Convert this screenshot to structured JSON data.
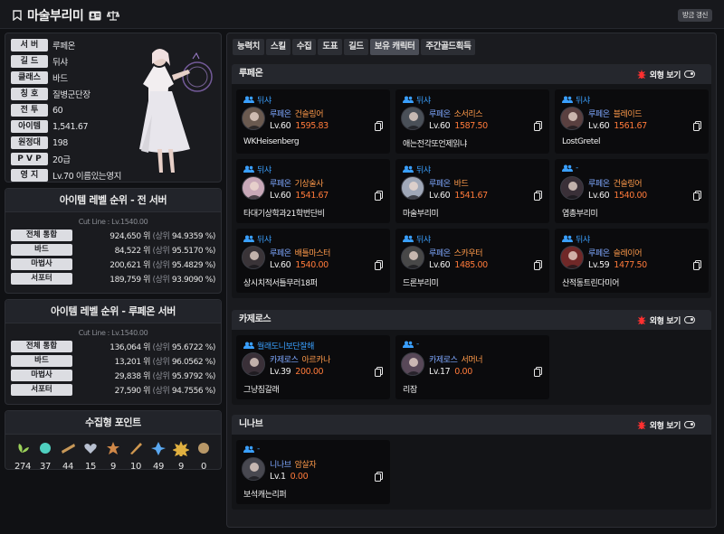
{
  "header": {
    "title": "마술부리미",
    "refresh_label": "방금 갱신"
  },
  "profile": {
    "rows": [
      {
        "label": "서 버",
        "value": "루페온"
      },
      {
        "label": "길 드",
        "value": "뒤샤"
      },
      {
        "label": "클래스",
        "value": "바드"
      },
      {
        "label": "칭 호",
        "value": "질병군단장"
      },
      {
        "label": "전 투",
        "value": "60"
      },
      {
        "label": "아이템",
        "value": "1,541.67"
      },
      {
        "label": "원정대",
        "value": "198"
      },
      {
        "label": "P V P",
        "value": "20급"
      },
      {
        "label": "영 지",
        "value": "Lv.70 이름있는영지"
      }
    ]
  },
  "rank_all": {
    "title": "아이템 레벨 순위 - 전 서버",
    "cutline": "Cut Line : Lv.1540.00",
    "rows": [
      {
        "label": "전체 통합",
        "rank": "924,650 위",
        "pct": "(상위",
        "value": "94.9359 %)"
      },
      {
        "label": "바드",
        "rank": "84,522 위",
        "pct": "(상위",
        "value": "95.5170 %)"
      },
      {
        "label": "마법사",
        "rank": "200,621 위",
        "pct": "(상위",
        "value": "95.4829 %)"
      },
      {
        "label": "서포터",
        "rank": "189,759 위",
        "pct": "(상위",
        "value": "93.9090 %)"
      }
    ]
  },
  "rank_server": {
    "title": "아이템 레벨 순위 - 루페온 서버",
    "cutline": "Cut Line : Lv.1540.00",
    "rows": [
      {
        "label": "전체 통합",
        "rank": "136,064 위",
        "pct": "(상위",
        "value": "95.6722 %)"
      },
      {
        "label": "바드",
        "rank": "13,201 위",
        "pct": "(상위",
        "value": "96.0562 %)"
      },
      {
        "label": "마법사",
        "rank": "29,838 위",
        "pct": "(상위",
        "value": "95.9792 %)"
      },
      {
        "label": "서포터",
        "rank": "27,590 위",
        "pct": "(상위",
        "value": "94.7556 %)"
      }
    ]
  },
  "collect": {
    "title": "수집형 포인트",
    "items": [
      {
        "icon": "seed-icon",
        "value": "274",
        "color": "#9bd05a"
      },
      {
        "icon": "island-icon",
        "value": "37",
        "color": "#4fd0c0"
      },
      {
        "icon": "painting-icon",
        "value": "44",
        "color": "#c89858"
      },
      {
        "icon": "heart-icon",
        "value": "15",
        "color": "#b8c0d0"
      },
      {
        "icon": "star-icon",
        "value": "9",
        "color": "#d08848"
      },
      {
        "icon": "feather-icon",
        "value": "10",
        "color": "#d09850"
      },
      {
        "icon": "leaf-icon",
        "value": "49",
        "color": "#5aa8f0"
      },
      {
        "icon": "sun-icon",
        "value": "9",
        "color": "#e0b040"
      },
      {
        "icon": "orb-icon",
        "value": "0",
        "color": "#b89868"
      }
    ]
  },
  "tabs": [
    "능력치",
    "스킬",
    "수집",
    "도표",
    "길드",
    "보유 캐릭터",
    "주간골드획득"
  ],
  "look_label": "외형 보기",
  "servers": [
    {
      "name": "루페온",
      "chars": [
        {
          "guild": "뒤샤",
          "server": "루페온",
          "job": "건슬링어",
          "lv": "Lv.60",
          "il": "1595.83",
          "nick": "WKHeisenberg"
        },
        {
          "guild": "뒤샤",
          "server": "루페온",
          "job": "소서리스",
          "lv": "Lv.60",
          "il": "1587.50",
          "nick": "애는전각또언제읽냐"
        },
        {
          "guild": "뒤샤",
          "server": "루페온",
          "job": "블레이드",
          "lv": "Lv.60",
          "il": "1561.67",
          "nick": "LostGretel"
        },
        {
          "guild": "뒤샤",
          "server": "루페온",
          "job": "기상술사",
          "lv": "Lv.60",
          "il": "1541.67",
          "nick": "타대기상학과21학번단비"
        },
        {
          "guild": "뒤샤",
          "server": "루페온",
          "job": "바드",
          "lv": "Lv.60",
          "il": "1541.67",
          "nick": "마술부리미"
        },
        {
          "guild": "-",
          "server": "루페온",
          "job": "건슬링어",
          "lv": "Lv.60",
          "il": "1540.00",
          "nick": "엽총부리미"
        },
        {
          "guild": "뒤샤",
          "server": "루페온",
          "job": "배틀마스터",
          "lv": "Lv.60",
          "il": "1540.00",
          "nick": "상시치적서틀무러18퍼"
        },
        {
          "guild": "뒤샤",
          "server": "루페온",
          "job": "스카우터",
          "lv": "Lv.60",
          "il": "1485.00",
          "nick": "드론부리미"
        },
        {
          "guild": "뒤샤",
          "server": "루페온",
          "job": "슬레이어",
          "lv": "Lv.59",
          "il": "1477.50",
          "nick": "산적동트린다미어"
        }
      ]
    },
    {
      "name": "카제로스",
      "chars": [
        {
          "guild": "월래도니보단잘해",
          "server": "카제로스",
          "job": "아르카나",
          "lv": "Lv.39",
          "il": "200.00",
          "nick": "그냥짐갈래"
        },
        {
          "guild": "-",
          "server": "카제로스",
          "job": "서머너",
          "lv": "Lv.17",
          "il": "0.00",
          "nick": "리잠"
        }
      ]
    },
    {
      "name": "니나브",
      "chars": [
        {
          "guild": "-",
          "server": "니나브",
          "job": "암살자",
          "lv": "Lv.1",
          "il": "0.00",
          "nick": "보석캐는리퍼"
        }
      ]
    }
  ],
  "avatar_colors": [
    "#6a5a50",
    "#4a5058",
    "#5a4040",
    "#c8a8b8",
    "#a0a8b8",
    "#3a3038",
    "#3a3438",
    "#484848",
    "#702828",
    "#3a3038",
    "#584858",
    "#484850"
  ]
}
